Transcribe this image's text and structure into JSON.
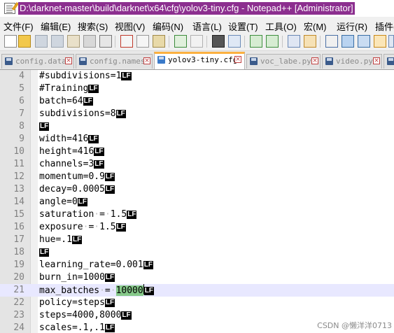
{
  "window": {
    "title": "D:\\darknet-master\\build\\darknet\\x64\\cfg\\yolov3-tiny.cfg - Notepad++ [Administrator]"
  },
  "menu": [
    "文件(F)",
    "编辑(E)",
    "搜索(S)",
    "视图(V)",
    "编码(N)",
    "语言(L)",
    "设置(T)",
    "工具(O)",
    "宏(M)",
    "运行(R)",
    "插件("
  ],
  "tabs": [
    {
      "label": "config.data",
      "active": false
    },
    {
      "label": "config.names",
      "active": false
    },
    {
      "label": "yolov3-tiny.cfg",
      "active": true
    },
    {
      "label": "voc_labe.py",
      "active": false
    },
    {
      "label": "video.py",
      "active": false
    }
  ],
  "eol_marker": "LF",
  "lines": [
    {
      "num": "4",
      "text": "#subdivisions=1"
    },
    {
      "num": "5",
      "text": "#Training"
    },
    {
      "num": "6",
      "text": "batch=64"
    },
    {
      "num": "7",
      "text": "subdivisions=8"
    },
    {
      "num": "8",
      "text": ""
    },
    {
      "num": "9",
      "text": "width=416"
    },
    {
      "num": "10",
      "text": "height=416"
    },
    {
      "num": "11",
      "text": "channels=3"
    },
    {
      "num": "12",
      "text": "momentum=0.9"
    },
    {
      "num": "13",
      "text": "decay=0.0005"
    },
    {
      "num": "14",
      "text": "angle=0"
    },
    {
      "num": "15",
      "text": "saturation = 1.5"
    },
    {
      "num": "16",
      "text": "exposure = 1.5"
    },
    {
      "num": "17",
      "text": "hue=.1"
    },
    {
      "num": "18",
      "text": ""
    },
    {
      "num": "19",
      "text": "learning_rate=0.001"
    },
    {
      "num": "20",
      "text": "burn_in=1000"
    },
    {
      "num": "21",
      "text": "max_batches = 10000",
      "current": true,
      "highlight": "10000"
    },
    {
      "num": "22",
      "text": "policy=steps"
    },
    {
      "num": "23",
      "text": "steps=4000,8000"
    },
    {
      "num": "24",
      "text": "scales=.1,.1"
    }
  ],
  "watermark": "CSDN @懒洋洋0713",
  "colors": {
    "title_highlight": "#8c2f8f",
    "active_tab_accent": "#fbb040",
    "current_line": "#e8e8ff",
    "selection_highlight": "#86c98a"
  }
}
